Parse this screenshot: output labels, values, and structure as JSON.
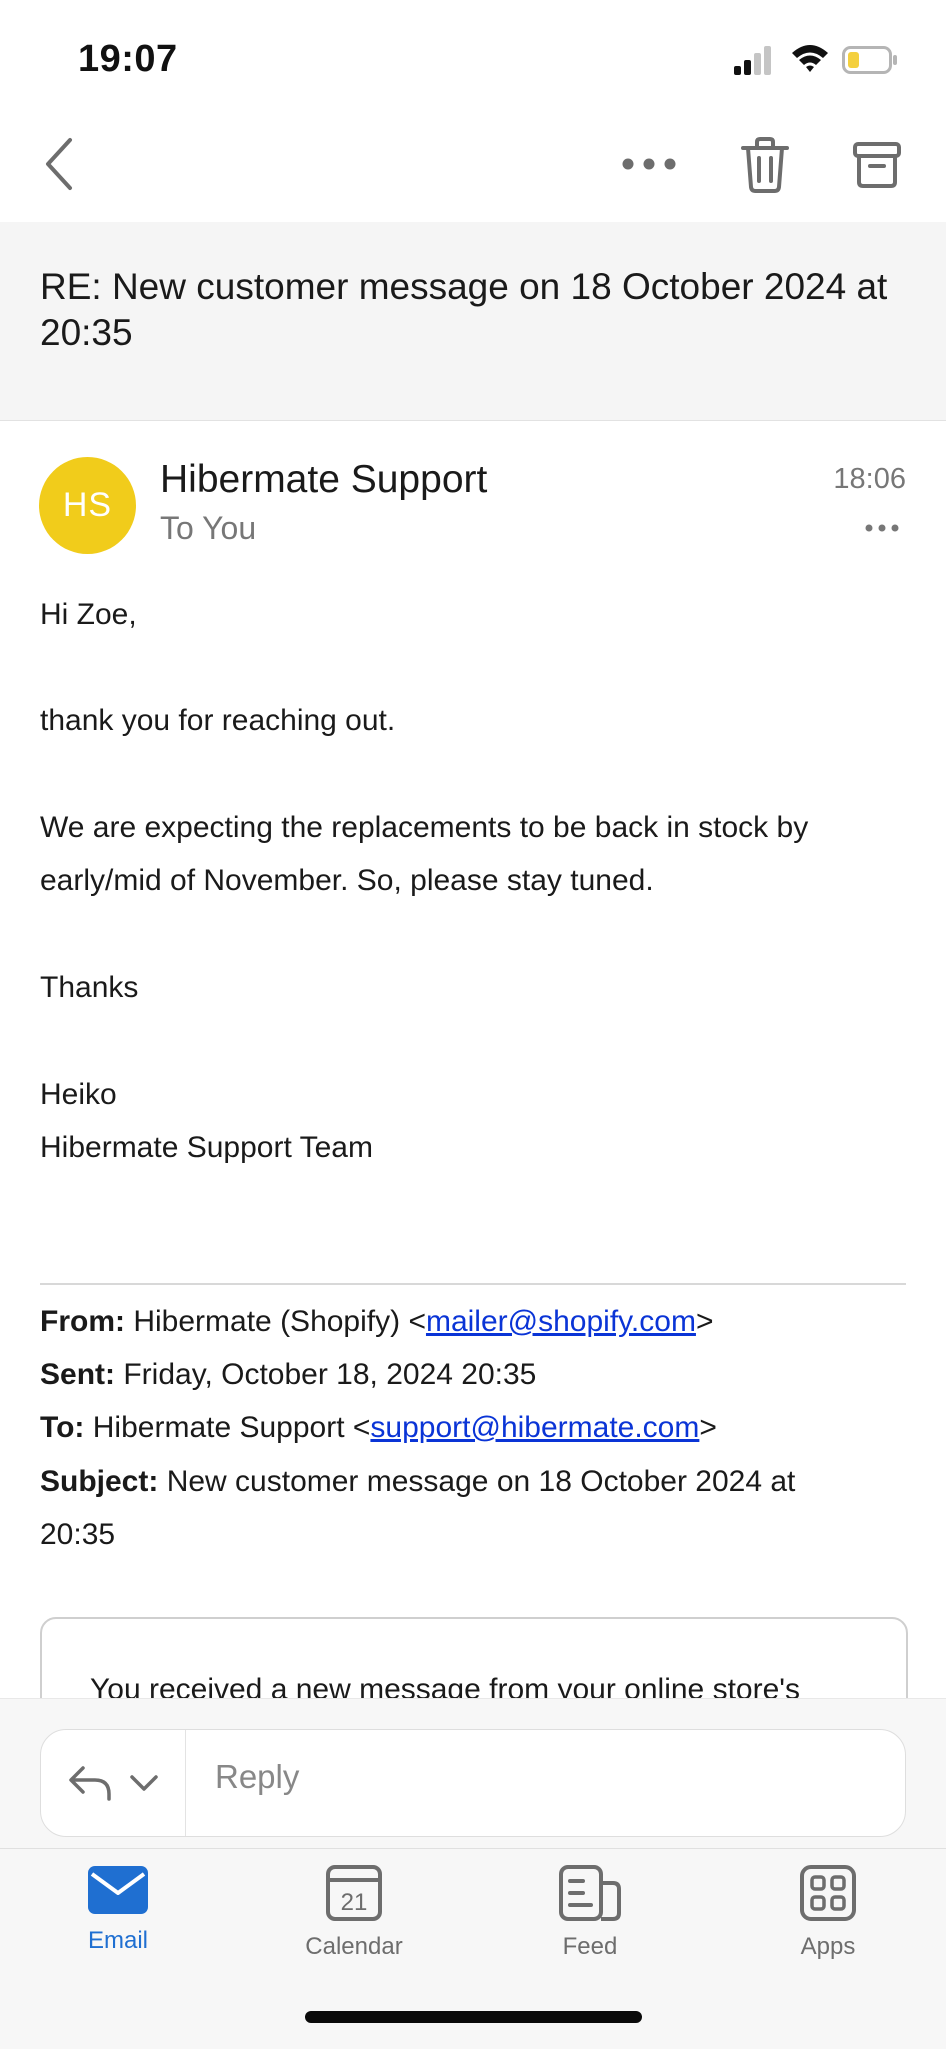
{
  "status_bar": {
    "time": "19:07",
    "icons": [
      "signal-icon",
      "wifi-icon",
      "battery-icon"
    ]
  },
  "toolbar": {
    "icons": [
      "back-icon",
      "more-icon",
      "trash-icon",
      "archive-icon"
    ]
  },
  "subject": "RE: New customer message on 18 October 2024 at 20:35",
  "message": {
    "avatar_initials": "HS",
    "avatar_color": "#f1cc1b",
    "sender": "Hibermate Support",
    "recipient": "To You",
    "time": "18:06",
    "body": [
      "Hi Zoe,",
      "thank you for reaching out.",
      "We are expecting the replacements to be back in stock by",
      "early/mid of November. So, please stay tuned.",
      "Thanks",
      "Heiko",
      "Hibermate Support Team"
    ],
    "quoted_header": {
      "from_label": "From:",
      "from_name": "Hibermate (Shopify) <",
      "from_email": "mailer@shopify.com",
      "from_close": ">",
      "sent_label": "Sent:",
      "sent_value": "Friday, October 18, 2024 20:35",
      "to_label": "To:",
      "to_name": "Hibermate Support <",
      "to_email": "support@hibermate.com",
      "to_close": ">",
      "subject_label": "Subject:",
      "subject_value_line1": "New customer message on 18 October 2024 at",
      "subject_value_line2": "20:35"
    },
    "quoted_box_text": "You received a new message from your online store's"
  },
  "reply": {
    "placeholder": "Reply",
    "icons": [
      "reply-icon",
      "chevron-down-icon"
    ]
  },
  "tabs": [
    {
      "label": "Email",
      "icon": "email-icon",
      "active": true
    },
    {
      "label": "Calendar",
      "icon": "calendar-icon",
      "day": "21"
    },
    {
      "label": "Feed",
      "icon": "feed-icon"
    },
    {
      "label": "Apps",
      "icon": "apps-icon"
    }
  ],
  "colors": {
    "accent": "#1f6fd1",
    "link": "#0a34d6",
    "battery_level": "#f4d03f"
  }
}
